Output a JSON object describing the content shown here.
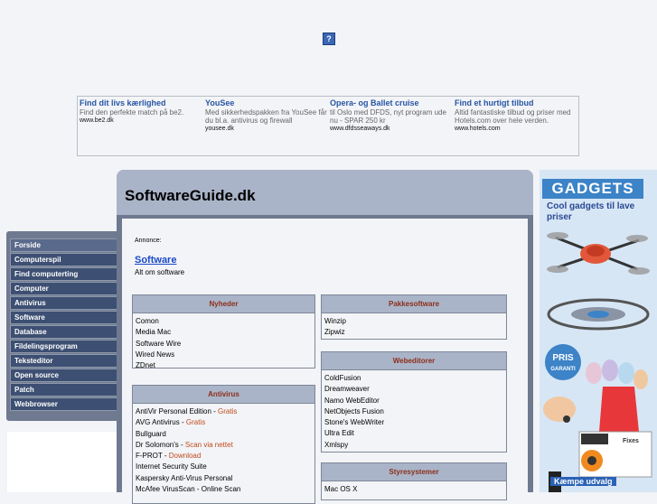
{
  "top_icon": {
    "glyph": "?"
  },
  "ad_strip": [
    {
      "title": "Find dit livs kærlighed",
      "desc": "Find den perfekte match på be2.",
      "url": "www.be2.dk"
    },
    {
      "title": "YouSee",
      "desc": "Med sikkerhedspakken fra YouSee får du bl.a. antivirus og firewall",
      "url": "yousee.dk"
    },
    {
      "title": "Opera- og Ballet cruise",
      "desc": "til Oslo med DFDS, nyt program ude nu - SPAR 250 kr",
      "url": "www.dfdsseaways.dk"
    },
    {
      "title": "Find et hurtigt tilbud",
      "desc": "Altid fantastiske tilbud og priser med Hotels.com over hele verden.",
      "url": "www.hotels.com"
    }
  ],
  "nav": {
    "items": [
      "Forside",
      "Computerspil",
      "Find computerting",
      "Computer",
      "Antivirus",
      "Software",
      "Database",
      "Fildelingsprogram",
      "Teksteditor",
      "Open source",
      "Patch",
      "Webbrowser"
    ]
  },
  "header": {
    "title": "SoftwareGuide.dk"
  },
  "annonce": "Annonce:",
  "software_link": {
    "label": "Software",
    "desc": "Alt om software"
  },
  "boxes": {
    "nyheder": {
      "title": "Nyheder",
      "items": [
        {
          "label": "Comon"
        },
        {
          "label": "Media Mac"
        },
        {
          "label": "Software Wire"
        },
        {
          "label": "Wired News"
        },
        {
          "label": "ZDnet"
        }
      ]
    },
    "antivirus": {
      "title": "Antivirus",
      "items": [
        {
          "label": "AntiVir Personal Edition",
          "suffix": "Gratis"
        },
        {
          "label": "AVG Antivirus",
          "suffix": "Gratis"
        },
        {
          "label": "Bullguard"
        },
        {
          "label": "Dr Solomon's",
          "suffix": "Scan via nettet"
        },
        {
          "label": "F-PROT",
          "suffix": "Download"
        },
        {
          "label": "Internet Security Suite"
        },
        {
          "label": "Kaspersky Anti-Virus Personal"
        },
        {
          "label": "McAfee VirusScan",
          "suffix": "Online Scan",
          "suffix_plain": true
        }
      ]
    },
    "pakkesoftware": {
      "title": "Pakkesoftware",
      "items": [
        {
          "label": "Winzip"
        },
        {
          "label": "Zipwiz"
        }
      ]
    },
    "webeditorer": {
      "title": "Webeditorer",
      "items": [
        {
          "label": "ColdFusion"
        },
        {
          "label": "Dreamweaver"
        },
        {
          "label": "Namo WebEditor"
        },
        {
          "label": "NetObjects Fusion"
        },
        {
          "label": "Stone's WebWriter"
        },
        {
          "label": "Ultra Edit"
        },
        {
          "label": "Xmlspy"
        }
      ]
    },
    "styresystemer": {
      "title": "Styresystemer",
      "items": [
        {
          "label": "Mac OS X"
        }
      ]
    }
  },
  "right_ad": {
    "title": "GADGETS",
    "subtitle": "Cool gadgets til lave priser",
    "price_badge": "PRIS GARANTI",
    "product_label": "Fixes",
    "bottom": "Kæmpe udvalg"
  },
  "colors": {
    "nav_bg": "#6f7a90",
    "nav_item": "#3d4f72",
    "header_bg": "#aab4c8",
    "box_title": "#8b2f1a",
    "link_blue": "#1a49c9",
    "ad_title_blue": "#2855a3",
    "gadgets_blue": "#3c83c7"
  }
}
